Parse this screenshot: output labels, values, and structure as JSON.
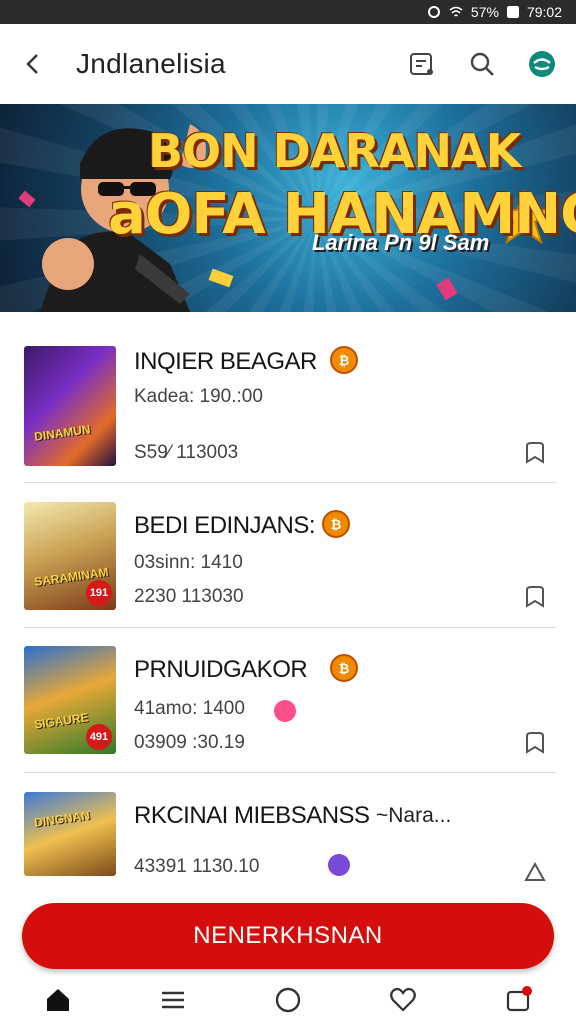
{
  "status_bar": {
    "battery_text": "57%",
    "time": "79:02"
  },
  "app_bar": {
    "back_icon": "chevron-left",
    "title": "Jndlanelisia"
  },
  "banner": {
    "headline_line1": "BON DARANAK",
    "headline_line2": "aOFA HANAMNG",
    "subline": "Larina Pn 9l Sam"
  },
  "items": [
    {
      "name": "INQIER BEAGAR",
      "line1": "Kadea: 190.:00",
      "line2": "S59⁄ 113003",
      "thumb_art": "DINAMUN",
      "thumb_badge": ""
    },
    {
      "name": "BEDI EDINJANS:",
      "line1": "03sinn: 1410",
      "line2": "2230 113030",
      "thumb_art": "SARAMINAM",
      "thumb_badge": "191"
    },
    {
      "name": "PRNUIDGAKOR",
      "line1": "41amo: 1400",
      "line2": "03909 :30.19",
      "thumb_art": "SIGAURE",
      "thumb_badge": "491"
    },
    {
      "name": "RKCINAI MIEBSANSS",
      "name_suffix": "~Nara...",
      "line1": "43391 1130.10",
      "thumb_art": "DINGNAN",
      "thumb_badge": ""
    }
  ],
  "cta": {
    "label": "NENERKHSNAN"
  },
  "colors": {
    "accent": "#d40d0d",
    "coin": "#f08a00",
    "banner_bg": "#1d6f9c"
  },
  "bottom_nav": [
    {
      "icon": "home-icon"
    },
    {
      "icon": "list-icon"
    },
    {
      "icon": "circle-icon"
    },
    {
      "icon": "heart-icon"
    },
    {
      "icon": "inbox-icon"
    }
  ]
}
